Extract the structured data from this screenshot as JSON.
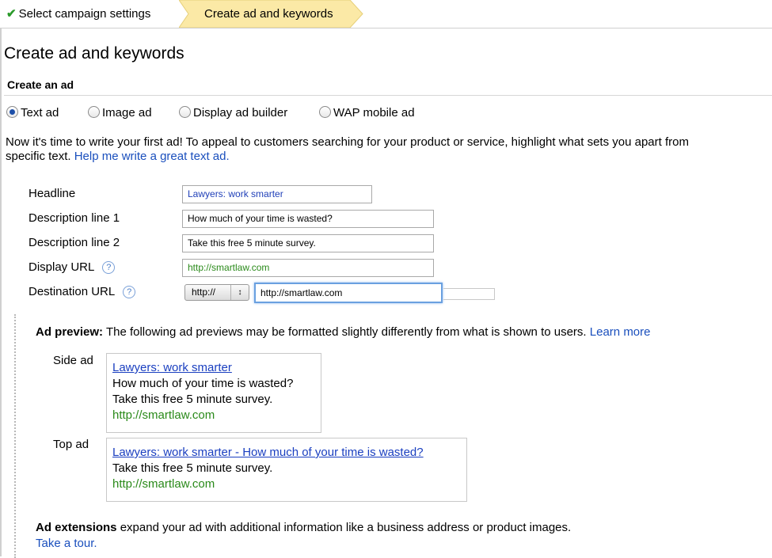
{
  "breadcrumbs": {
    "step1": "Select campaign settings",
    "step2": "Create ad and keywords"
  },
  "page_title": "Create ad and keywords",
  "section_title": "Create an ad",
  "ad_types": [
    {
      "label": "Text ad",
      "selected": true
    },
    {
      "label": "Image ad",
      "selected": false
    },
    {
      "label": "Display ad builder",
      "selected": false
    },
    {
      "label": "WAP mobile ad",
      "selected": false
    }
  ],
  "intro": {
    "text1": "Now it's time to write your first ad! To appeal to customers searching for your product or service, highlight what sets you apart from",
    "text2": "specific text.",
    "help_link": "Help me write a great text ad."
  },
  "form": {
    "headline_label": "Headline",
    "headline_value": "Lawyers: work smarter",
    "desc1_label": "Description line 1",
    "desc1_value": "How much of your time is wasted?",
    "desc2_label": "Description line 2",
    "desc2_value": "Take this free 5 minute survey.",
    "display_url_label": "Display URL",
    "display_url_value": "http://smartlaw.com",
    "dest_url_label": "Destination URL",
    "protocol_value": "http://",
    "dest_url_value": "http://smartlaw.com",
    "help_glyph": "?"
  },
  "preview": {
    "bold_label": "Ad preview:",
    "text": "The following ad previews may be formatted slightly differently from what is shown to users.",
    "learn_more": "Learn more",
    "side_label": "Side ad",
    "side_headline": "Lawyers: work smarter",
    "side_line1": "How much of your time is wasted?",
    "side_line2": "Take this free 5 minute survey.",
    "side_url": "http://smartlaw.com",
    "top_label": "Top ad",
    "top_headline": "Lawyers: work smarter - How much of your time is wasted?",
    "top_line1": "Take this free 5 minute survey.",
    "top_url": "http://smartlaw.com"
  },
  "extensions": {
    "bold_label": "Ad extensions",
    "text": "expand your ad with additional information like a business address or product images.",
    "tour_link": "Take a tour."
  },
  "colors": {
    "link": "#1a4fbd",
    "url_green": "#2a8a1a",
    "active_step": "#fbe9a6",
    "check_green": "#2a9a2a"
  },
  "icons": {
    "step_done": "checkmark-icon",
    "help": "question-mark-icon",
    "select_arrows": "up-down-arrows-icon"
  }
}
